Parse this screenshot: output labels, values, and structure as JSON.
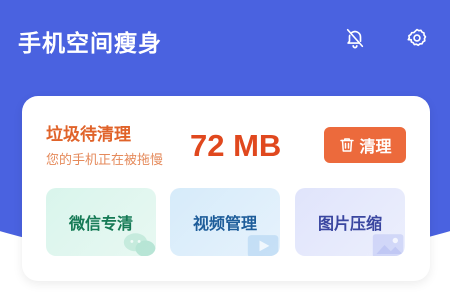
{
  "header": {
    "title": "手机空间瘦身",
    "bell_icon": "notifications-off-icon",
    "settings_icon": "gear-icon"
  },
  "cleanup_card": {
    "title": "垃圾待清理",
    "subtitle": "您的手机正在被拖慢",
    "junk_size": "72 MB",
    "clean_button": {
      "label": "清理",
      "icon": "trash-icon"
    }
  },
  "tools": [
    {
      "label": "微信专清",
      "icon": "wechat-icon"
    },
    {
      "label": "视频管理",
      "icon": "video-icon"
    },
    {
      "label": "图片压缩",
      "icon": "image-icon"
    }
  ],
  "colors": {
    "header_bg": "#4a62e0",
    "accent": "#ec6a3c",
    "size_text": "#e0481e"
  }
}
